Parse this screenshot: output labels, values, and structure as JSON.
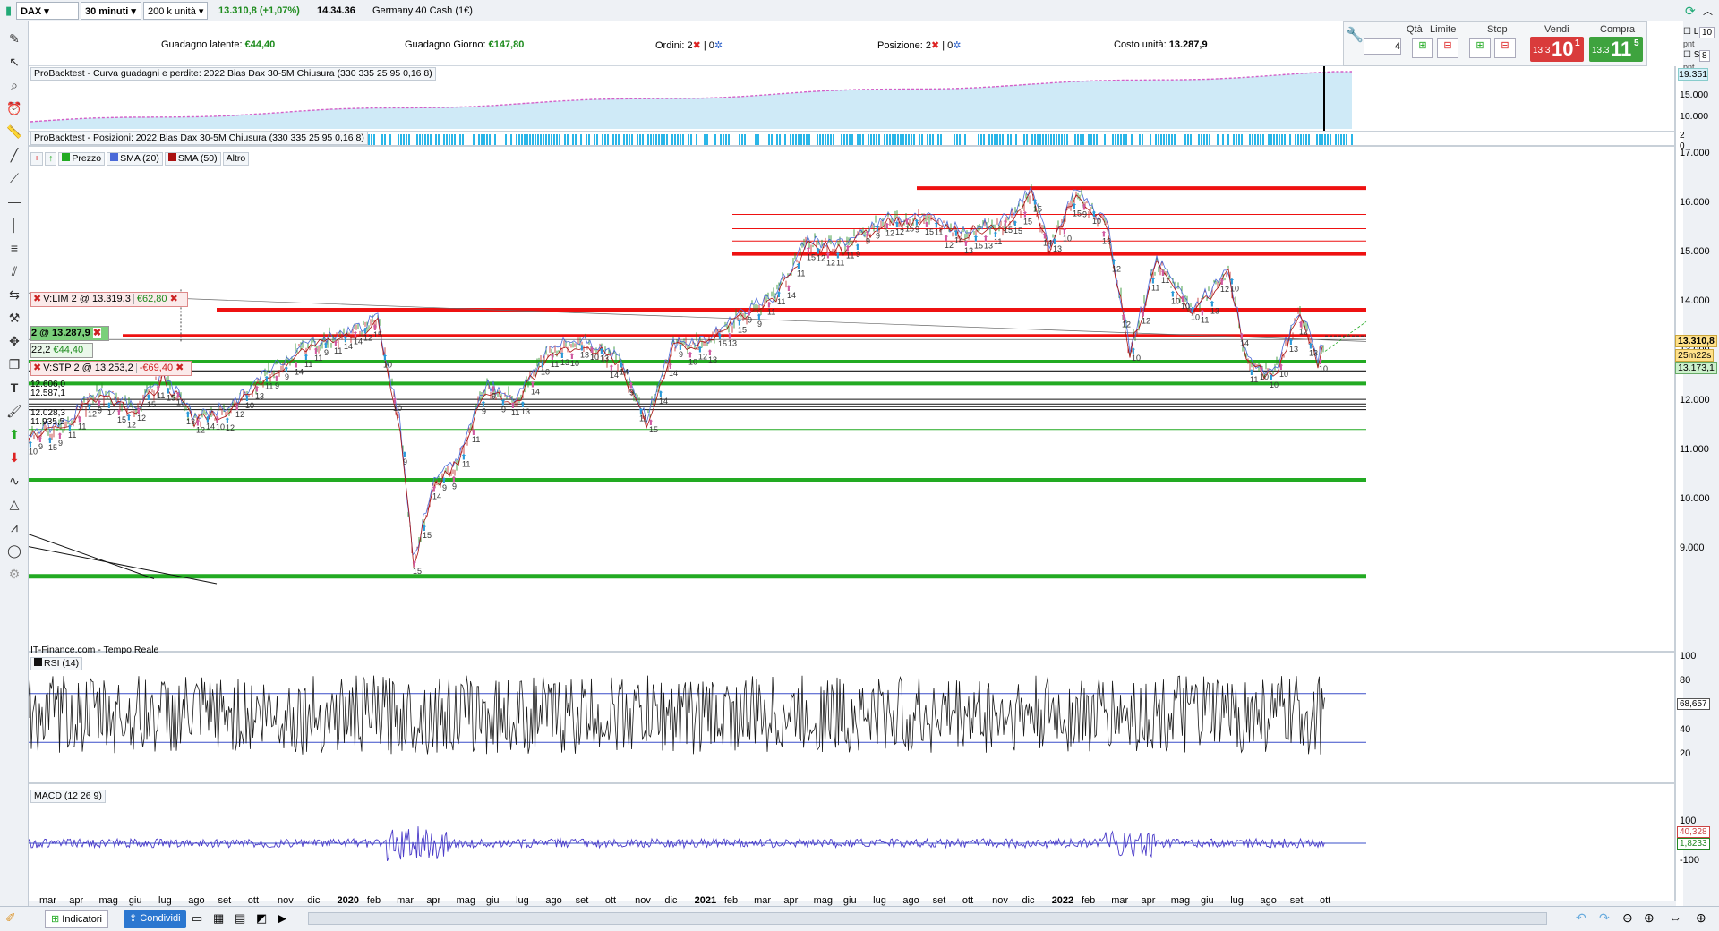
{
  "topbar": {
    "symbol": "DAX",
    "timeframe": "30 minuti",
    "units": "200 k unità",
    "price": "13.310,8",
    "change": "(+1,07%)",
    "time": "14.34.36",
    "instrument": "Germany 40 Cash (1€)"
  },
  "pnl": {
    "latent_label": "Guadagno latente:",
    "latent_value": "€44,40",
    "day_label": "Guadagno Giorno:",
    "day_value": "€147,80",
    "orders_label": "Ordini:",
    "orders_a": "2",
    "orders_b": "0",
    "positions_label": "Posizione:",
    "positions_a": "2",
    "positions_b": "0",
    "unit_cost_label": "Costo unità:",
    "unit_cost_value": "13.287,9"
  },
  "order_panel": {
    "qty_label": "Qtà",
    "qty_value": "4",
    "limit_label": "Limite",
    "stop_label": "Stop",
    "sell_label": "Vendi",
    "buy_label": "Compra",
    "sell_price_small": "13.3",
    "sell_price_big": "10",
    "sell_price_sup": "1",
    "buy_price_small": "13.3",
    "buy_price_big": "11",
    "buy_price_sup": "5",
    "l_label": "L",
    "l_value": "10",
    "s_label": "S",
    "s_value": "8",
    "pnt": "pnt"
  },
  "panels": {
    "equity_title": "ProBacktest - Curva guadagni e perdite: 2022 Bias Dax 30-5M Chiusura (330 335 25 95 0,16 8)",
    "equity_axis": [
      "19.351",
      "15.000",
      "10.000"
    ],
    "positions_title": "ProBacktest - Posizioni: 2022 Bias Dax 30-5M Chiusura (330 335 25 95 0,16 8)",
    "positions_axis": [
      "2",
      "0"
    ],
    "price_legend": [
      "Prezzo",
      "SMA (20)",
      "SMA (50)",
      "Altro"
    ],
    "price_axis": [
      "17.000",
      "16.000",
      "15.000",
      "14.000",
      "13.000",
      "12.000",
      "11.000",
      "10.000",
      "9.000"
    ],
    "price_current": "13.310,8",
    "countdown": "25m22s",
    "price_other": "13.173,1",
    "source": "IT-Finance.com - Tempo Reale",
    "rsi_title": "RSI (14)",
    "rsi_axis": [
      "100",
      "80",
      "60",
      "40",
      "20"
    ],
    "rsi_value": "68,657",
    "macd_title": "MACD (12 26 9)",
    "macd_axis": [
      "100",
      "-100"
    ],
    "macd_values": [
      "40,328",
      "1,8233"
    ]
  },
  "orders_on_chart": {
    "limit_label": "V:LIM",
    "limit_text": "2 @ 13.319,3",
    "limit_pnl": "€62,80",
    "pos_text": "2 @ 13.287,9",
    "pos_qty": "22,2",
    "pos_pnl": "€44,40",
    "stop_label": "V:STP",
    "stop_text": "2 @ 13.253,2",
    "stop_pnl": "-€69,40",
    "level_labels": [
      "12.606,0",
      "12.587,1",
      "12.028,3",
      "11.935,5"
    ]
  },
  "xaxis": [
    "mar",
    "apr",
    "mag",
    "giu",
    "lug",
    "ago",
    "set",
    "ott",
    "nov",
    "dic",
    "2020",
    "feb",
    "mar",
    "apr",
    "mag",
    "giu",
    "lug",
    "ago",
    "set",
    "ott",
    "nov",
    "dic",
    "2021",
    "feb",
    "mar",
    "apr",
    "mag",
    "giu",
    "lug",
    "ago",
    "set",
    "ott",
    "nov",
    "dic",
    "2022",
    "feb",
    "mar",
    "apr",
    "mag",
    "giu",
    "lug",
    "ago",
    "set",
    "ott"
  ],
  "bottombar": {
    "indicators": "Indicatori",
    "share": "Condividi"
  },
  "colors": {
    "sell": "#d93b3b",
    "buy": "#3ea33e",
    "resistance": "#ee1111",
    "support": "#22aa22",
    "equity_fill": "#cfeaf7",
    "rsi_macd_line": "#1a1a1a",
    "macd_line": "#4b3cc9"
  }
}
